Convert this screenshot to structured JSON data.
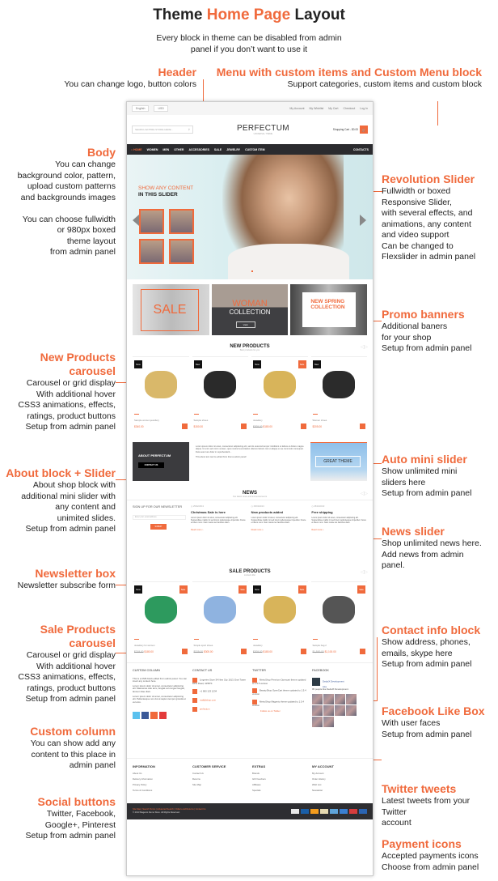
{
  "title": {
    "part1": "Theme ",
    "part2": "Home Page",
    "part3": " Layout"
  },
  "subtitle": "Every block in theme can be disabled from admin panel if you don’t want to use it",
  "notes": {
    "header": {
      "title": "Header",
      "desc": "You can change logo, button colors"
    },
    "menu": {
      "title": "Menu with custom items and Custom Menu block",
      "desc": "Support categories, custom items and custom block"
    },
    "body": {
      "title": "Body",
      "desc": "You can change\nbackground color, pattern,\nupload custom patterns\nand backgrounds images\n\nYou can choose fullwidth\nor 980px boxed\ntheme layout\nfrom admin panel"
    },
    "revolution": {
      "title": "Revolution Slider",
      "desc": "Fullwidth or boxed\nResponsive Slider,\nwith several effects, and\nanimations, any content\nand video support\nCan be changed to\nFlexslider in admin panel"
    },
    "promo": {
      "title": "Promo banners",
      "desc": "Additional baners\nfor your shop\nSetup from admin panel"
    },
    "newprod": {
      "title": "New Products\ncarousel",
      "desc": "Carousel or grid display\nWith additional hover\nCSS3 animations, effects,\nratings, product buttons\nSetup from admin panel"
    },
    "about": {
      "title": "About block + Slider",
      "desc": "About shop block with\nadditional mini slider with\nany content and\nunimited slides.\nSetup from admin panel"
    },
    "automini": {
      "title": "Auto mini slider",
      "desc": "Show unlimited mini\nsliders here\nSetup from admin panel"
    },
    "news": {
      "title": "News slider",
      "desc": "Shop unlimited news here.\nAdd news from admin\npanel."
    },
    "newsletter": {
      "title": "Newsletter box",
      "desc": "Newsletter subscribe form"
    },
    "sale": {
      "title": "Sale Products\ncarousel",
      "desc": "Carousel or grid display\nWith additional hover\nCSS3 animations, effects,\nratings, product buttons\nSetup from admin panel"
    },
    "contact": {
      "title": "Contact info block",
      "desc": "Show address, phones,\nemails, skype here\nSetup from admin panel"
    },
    "facebook": {
      "title": "Facebook Like Box",
      "desc": "With user faces\nSetup from admin panel"
    },
    "custom": {
      "title": "Custom column",
      "desc": "You can show add any\ncontent to this place in\nadmin panel"
    },
    "twitter": {
      "title": "Twitter tweets",
      "desc": "Latest tweets from your\nTwitter\naccount"
    },
    "social": {
      "title": "Social buttons",
      "desc": "Twitter, Facebook,\nGoogle+, Pinterest\nSetup from admin panel"
    },
    "payment": {
      "title": "Payment icons",
      "desc": "Accepted payments icons\nChoose from admin panel"
    }
  },
  "mock": {
    "lang": "English",
    "currency": "USD",
    "toplinks": [
      "My Account",
      "My Wishlist",
      "My Cart",
      "Checkout",
      "Log In"
    ],
    "search_placeholder": "SEARCH ENTIRE STORE HERE...",
    "logo": "PERFECTUM",
    "logo_sub": "UNIVERSAL THEME",
    "cart": "Shopping Cart - $0.00",
    "nav": [
      "HOME",
      "WOMEN",
      "MEN",
      "OTHER",
      "ACCESSORIES",
      "SALE",
      "JEWELRY",
      "CUSTOM ITEM"
    ],
    "nav_right": "CONTACTS",
    "slider_h1": "SHOW ANY CONTENT",
    "slider_h2": "IN THIS SLIDER",
    "promo1": "SALE",
    "promo2a": "WOMAN",
    "promo2b": "COLLECTION",
    "promo_view": "view",
    "promo3": "NEW SPRING COLLECTION",
    "newprod_title": "NEW PRODUCTS",
    "newprod_sub": "Best products for you",
    "newprods": [
      {
        "name": "Sample women jewellery",
        "price": "$340.00",
        "old": "",
        "new": true,
        "sale": false
      },
      {
        "name": "Sample shoes",
        "price": "$150.00",
        "old": "",
        "new": true,
        "sale": false
      },
      {
        "name": "Jewellery",
        "price": "$180.00",
        "old": "$205.00",
        "new": true,
        "sale": true
      },
      {
        "name": "Women shoes",
        "price": "$205.00",
        "old": "",
        "new": true,
        "sale": false
      }
    ],
    "about_title": "ABOUT PERFECTUM",
    "about_btn": "CONTACT US",
    "about_text": "Lorem ipsum dolor sit amet, consectetur adipisicing elit, sed do eiusmod tempor incididunt ut labore et dolore magna aliqua. Ut enim ad minim veniam, quis nostrud exercitation ullamco laboris nisi ut aliquip ex ea commodo consequat. Duis aute irure dolor in reprehenderit...",
    "about_text2": "This about text can be edited from theme admin panel!",
    "mini_slider": "GREAT THEME",
    "news_title": "NEWS",
    "news_sub": "Our latest news and announcements",
    "newsletter_title": "SIGN UP FOR OUR NEWSLETTER",
    "newsletter_placeholder": "Enter your email address",
    "newsletter_btn": "SUBMIT",
    "news": [
      {
        "date": "25/02/2013",
        "title": "Christmas Sale is here"
      },
      {
        "date": "25/02/2013",
        "title": "New products added"
      },
      {
        "date": "25/02/2013",
        "title": "Free shipping"
      }
    ],
    "news_body": "Lorem ipsum dolor sit amet, consectetur adipiscing elit. Suspendisse mattis mi sed lorem pellentesque imperdiet. Fusce et libero nunc. Nam mante leo faucibus diam.",
    "read_more": "Read more",
    "sale_title": "SALE PRODUCTS",
    "sale_sub": "Limited offer",
    "saleprods": [
      {
        "name": "Jewellery for women",
        "price": "$180.00",
        "old": "$219.00",
        "new": true,
        "sale": true
      },
      {
        "name": "Simple sport shoes",
        "price": "$305.00",
        "old": "$325.00",
        "new": false,
        "sale": true
      },
      {
        "name": "Jewellery",
        "price": "$180.00",
        "old": "$205.00",
        "new": true,
        "sale": true
      },
      {
        "name": "Sample bag 2",
        "price": "$1,100.00",
        "old": "$1,500.00",
        "new": false,
        "sale": true
      }
    ],
    "custom_title": "CUSTOM COLUMN",
    "custom_text": "This is a CMS block edited from admin panel. You can insert any content here.",
    "custom_text2": "Lorem ipsum dolor sit amet, consectetur adipiscing elit. Maecenas odio arcu, feugiat vel congue feugiat, laoreet vitae diam.",
    "custom_text3": "Lorem ipsum dolor sit amet, consectetur adipiscing elit. Pellentesque non dui at sapien tempor gravida ut vel arcu.",
    "contact_title": "CONTACT US",
    "contact": [
      "Lingeries Store 54 New City 1613, Exet Tower DPG Road, 415874",
      "+1 800 123 1234",
      "mail@shop.com",
      "perfectum"
    ],
    "twitter_title": "TWITTER",
    "tweets": [
      "MetroShop Premium Opencart theme updated to 1.5.5 version",
      "BeautyShop OpenCart theme updated to 1.5.4 version",
      "MetroShop Magento theme updated to 1.5.4 version"
    ],
    "follow": "Follow us on Twitter",
    "facebook_title": "FACEBOOK",
    "fb_page": "DedaIX Development",
    "fb_like": "Like",
    "fb_count": "95 people like DedaIX Development.",
    "footer_cols": [
      {
        "title": "INFORMATION",
        "items": [
          "About Us",
          "Delivery Information",
          "Privacy Policy",
          "Terms & Conditions"
        ]
      },
      {
        "title": "CUSTOMER SERVICE",
        "items": [
          "Contact Us",
          "Returns",
          "Site Map"
        ]
      },
      {
        "title": "EXTRAS",
        "items": [
          "Brands",
          "Gift Vouchers",
          "Affiliates",
          "Specials"
        ]
      },
      {
        "title": "MY ACCOUNT",
        "items": [
          "My Account",
          "Order History",
          "Wish List",
          "Newsletter"
        ]
      }
    ],
    "bottom_links": "Site Map | Search Terms | Advanced Search | Orders and Returns | Contact Us",
    "copyright": "© 2013 Magento Demo Store. All Rights Reserved."
  },
  "colors": {
    "accent": "#f06a3c",
    "nav": "#2b2b2e"
  }
}
